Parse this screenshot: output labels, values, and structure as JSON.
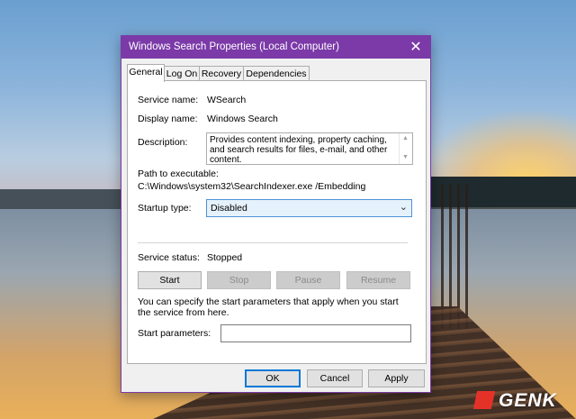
{
  "dialog": {
    "title": "Windows Search Properties (Local Computer)",
    "close_icon": "close-icon"
  },
  "tabs": [
    {
      "label": "General",
      "active": true
    },
    {
      "label": "Log On",
      "active": false
    },
    {
      "label": "Recovery",
      "active": false
    },
    {
      "label": "Dependencies",
      "active": false
    }
  ],
  "general": {
    "service_name_label": "Service name:",
    "service_name_value": "WSearch",
    "display_name_label": "Display name:",
    "display_name_value": "Windows Search",
    "description_label": "Description:",
    "description_value": "Provides content indexing, property caching, and search results for files, e-mail, and other content.",
    "path_label": "Path to executable:",
    "path_value": "C:\\Windows\\system32\\SearchIndexer.exe /Embedding",
    "startup_type_label": "Startup type:",
    "startup_type_value": "Disabled",
    "service_status_label": "Service status:",
    "service_status_value": "Stopped",
    "buttons": {
      "start": "Start",
      "stop": "Stop",
      "pause": "Pause",
      "resume": "Resume"
    },
    "info_text": "You can specify the start parameters that apply when you start the service from here.",
    "start_params_label": "Start parameters:",
    "start_params_value": ""
  },
  "footer": {
    "ok": "OK",
    "cancel": "Cancel",
    "apply": "Apply"
  },
  "watermark": "GENK",
  "colors": {
    "titlebar": "#7b3aa8",
    "focus_border": "#4f93d6"
  }
}
